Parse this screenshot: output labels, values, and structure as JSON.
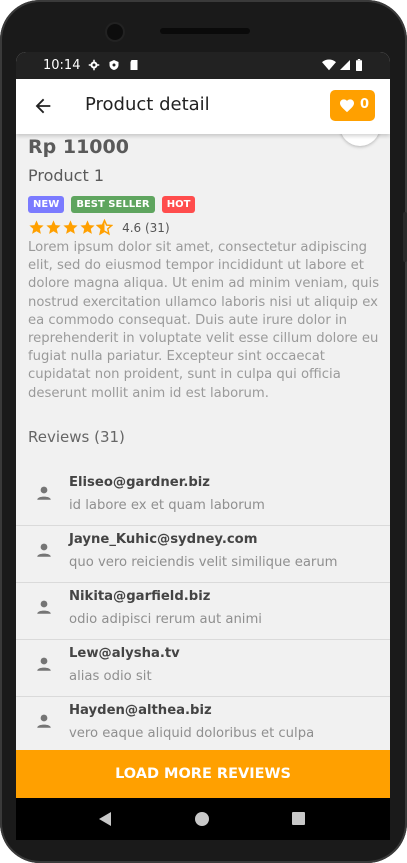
{
  "status_bar": {
    "time": "10:14",
    "icons": [
      "settings-icon",
      "shield-icon",
      "sd-card-icon",
      "wifi-icon",
      "signal-icon",
      "battery-icon"
    ]
  },
  "app_bar": {
    "title": "Product detail",
    "favorites_count": "0",
    "accent_color": "#ffa000"
  },
  "product": {
    "price": "Rp 11000",
    "name": "Product 1",
    "badges": [
      {
        "label": "NEW",
        "color": "#7b7bff"
      },
      {
        "label": "BEST SELLER",
        "color": "#5fa55f"
      },
      {
        "label": "HOT",
        "color": "#ff4d4d"
      }
    ],
    "rating_value": 4.6,
    "rating_text": "4.6 (31)",
    "description": "Lorem ipsum dolor sit amet, consectetur adipiscing elit, sed do eiusmod tempor incididunt ut labore et dolore magna aliqua. Ut enim ad minim veniam, quis nostrud exercitation ullamco laboris nisi ut aliquip ex ea commodo consequat. Duis aute irure dolor in reprehenderit in voluptate velit esse cillum dolore eu fugiat nulla pariatur. Excepteur sint occaecat cupidatat non proident, sunt in culpa qui officia deserunt mollit anim id est laborum."
  },
  "reviews": {
    "title": "Reviews (31)",
    "items": [
      {
        "email": "Eliseo@gardner.biz",
        "text": "id labore ex et quam laborum"
      },
      {
        "email": "Jayne_Kuhic@sydney.com",
        "text": "quo vero reiciendis velit similique earum"
      },
      {
        "email": "Nikita@garfield.biz",
        "text": "odio adipisci rerum aut animi"
      },
      {
        "email": "Lew@alysha.tv",
        "text": "alias odio sit"
      },
      {
        "email": "Hayden@althea.biz",
        "text": "vero eaque aliquid doloribus et culpa"
      }
    ],
    "load_more_label": "LOAD MORE REVIEWS"
  }
}
